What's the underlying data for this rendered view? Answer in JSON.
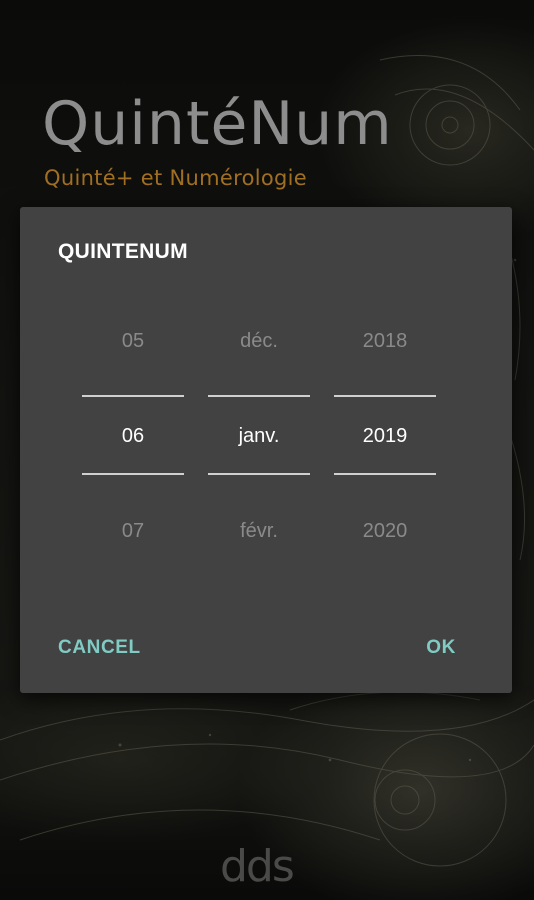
{
  "app": {
    "logo_title": "QuintéNum",
    "logo_subtitle": "Quinté+ et Numérologie",
    "footer_logo": "dds"
  },
  "dialog": {
    "title": "QUINTENUM",
    "day": {
      "prev": "05",
      "current": "06",
      "next": "07"
    },
    "month": {
      "prev": "déc.",
      "current": "janv.",
      "next": "févr."
    },
    "year": {
      "prev": "2018",
      "current": "2019",
      "next": "2020"
    },
    "cancel_label": "CANCEL",
    "ok_label": "OK"
  },
  "colors": {
    "dialog_background": "#424242",
    "accent": "#80cbc4",
    "logo_gray": "#8d8d8d",
    "logo_orange": "#a06f22"
  }
}
